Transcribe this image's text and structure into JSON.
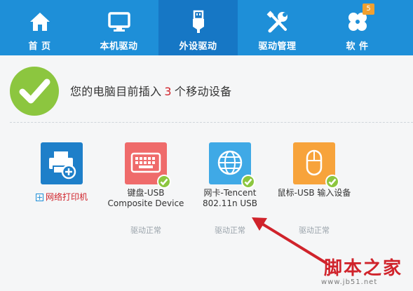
{
  "nav": {
    "items": [
      {
        "label": "首 页",
        "icon": "home-icon"
      },
      {
        "label": "本机驱动",
        "icon": "monitor-icon"
      },
      {
        "label": "外设驱动",
        "icon": "usb-icon"
      },
      {
        "label": "驱动管理",
        "icon": "tools-icon"
      },
      {
        "label": "软 件",
        "icon": "clover-icon"
      }
    ],
    "active_index": 2,
    "software_badge": "5"
  },
  "summary": {
    "prefix": "您的电脑目前插入",
    "count": "3",
    "suffix": "个移动设备"
  },
  "devices": [
    {
      "name": "网络打印机",
      "action_icon": "plus",
      "status": "",
      "color": "#1e7fc9"
    },
    {
      "name": "键盘-USB Composite Device",
      "status": "驱动正常",
      "color": "#ef6b6b"
    },
    {
      "name": "网卡-Tencent 802.11n USB",
      "status": "驱动正常",
      "color": "#3fa9e6"
    },
    {
      "name": "鼠标-USB 输入设备",
      "status": "驱动正常",
      "color": "#f7a33b"
    }
  ],
  "watermark": {
    "main": "脚本之家",
    "url": "www.jb51.net"
  },
  "colors": {
    "nav_bg": "#1e8fd8",
    "nav_active": "#1677c5",
    "accent_green": "#8cc63f",
    "alert_red": "#d0232b"
  }
}
